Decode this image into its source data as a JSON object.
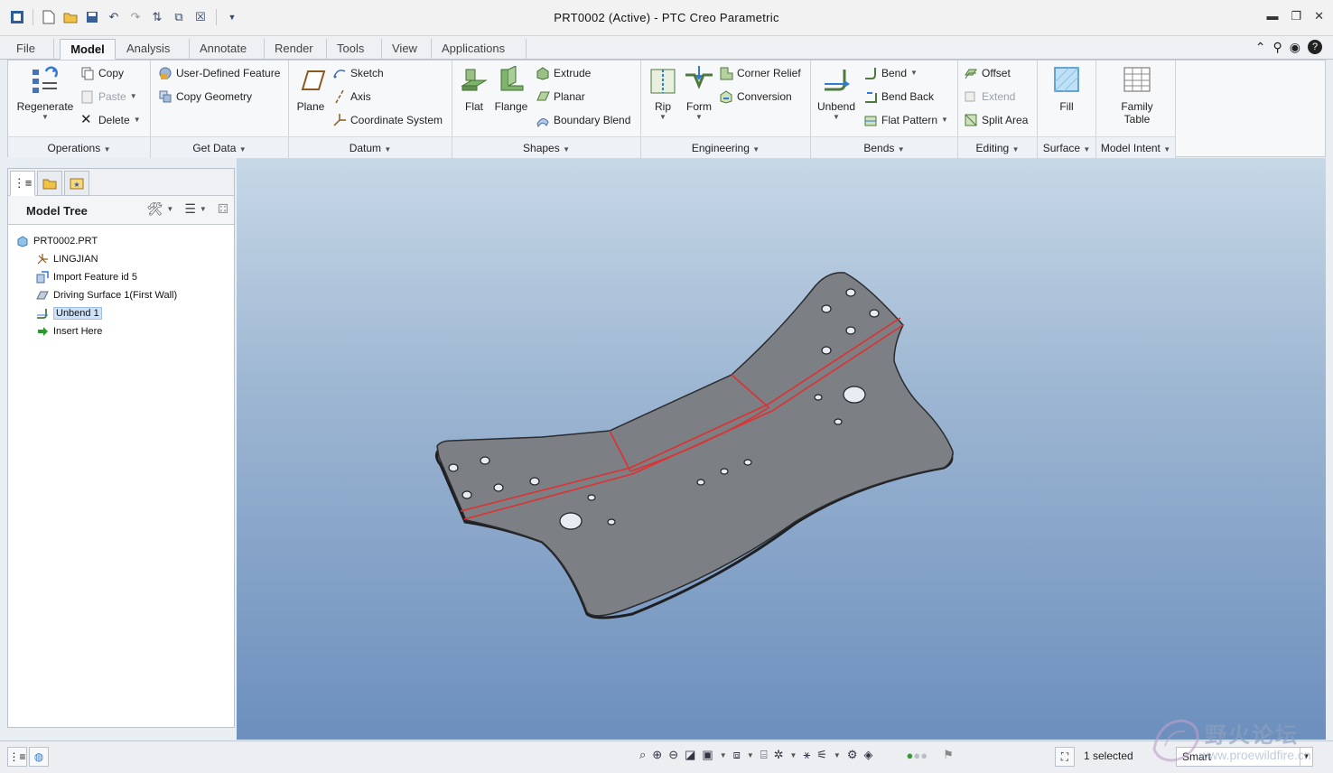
{
  "window": {
    "title": "PRT0002 (Active) - PTC Creo Parametric",
    "controls": [
      "minimize",
      "maximize",
      "close"
    ]
  },
  "quick_access": [
    "app-icon",
    "new-icon",
    "open-icon",
    "save-icon",
    "undo-icon",
    "redo-icon",
    "regenerate-icon",
    "windows-icon",
    "close-window-icon",
    "customize-icon"
  ],
  "tabs": [
    {
      "label": "File",
      "dropdown": true
    },
    {
      "label": "Model",
      "active": true
    },
    {
      "label": "Analysis"
    },
    {
      "label": "Annotate"
    },
    {
      "label": "Render"
    },
    {
      "label": "Tools"
    },
    {
      "label": "View"
    },
    {
      "label": "Applications"
    }
  ],
  "ribbon": {
    "operations": {
      "label": "Operations",
      "regenerate": "Regenerate",
      "copy": "Copy",
      "paste": "Paste",
      "delete": "Delete"
    },
    "get_data": {
      "label": "Get Data",
      "udf": "User-Defined Feature",
      "copy_geometry": "Copy Geometry"
    },
    "datum": {
      "label": "Datum",
      "plane": "Plane",
      "sketch": "Sketch",
      "axis": "Axis",
      "csys": "Coordinate System"
    },
    "shapes": {
      "label": "Shapes",
      "flat": "Flat",
      "flange": "Flange",
      "extrude": "Extrude",
      "planar": "Planar",
      "boundary_blend": "Boundary Blend"
    },
    "engineering": {
      "label": "Engineering",
      "rip": "Rip",
      "form": "Form",
      "corner_relief": "Corner Relief",
      "conversion": "Conversion"
    },
    "bends": {
      "label": "Bends",
      "unbend": "Unbend",
      "bend": "Bend",
      "bend_back": "Bend Back",
      "flat_pattern": "Flat Pattern"
    },
    "editing": {
      "label": "Editing",
      "offset": "Offset",
      "extend": "Extend",
      "split_area": "Split Area"
    },
    "surface": {
      "label": "Surface",
      "fill": "Fill"
    },
    "model_intent": {
      "label": "Model Intent",
      "family_table_1": "Family",
      "family_table_2": "Table"
    }
  },
  "model_tree": {
    "title": "Model Tree",
    "nodes": [
      {
        "label": "PRT0002.PRT",
        "icon": "part-icon"
      },
      {
        "label": "LINGJIAN",
        "icon": "csys-icon"
      },
      {
        "label": "Import Feature id 5",
        "icon": "import-feature-icon"
      },
      {
        "label": "Driving Surface 1(First Wall)",
        "icon": "driving-surface-icon"
      },
      {
        "label": "Unbend 1",
        "icon": "unbend-icon",
        "selected": true
      },
      {
        "label": "Insert Here",
        "icon": "insert-arrow-icon"
      }
    ]
  },
  "status": {
    "selection": "1 selected",
    "filter": "Smart"
  },
  "watermark": {
    "text": "野火论坛",
    "url": "www.proewildfire.cn"
  },
  "colors": {
    "bend_lines": "#e03030",
    "part_fill": "#7c7f84",
    "viewport_top": "#c7d8e7",
    "viewport_bottom": "#6c8fbd"
  }
}
